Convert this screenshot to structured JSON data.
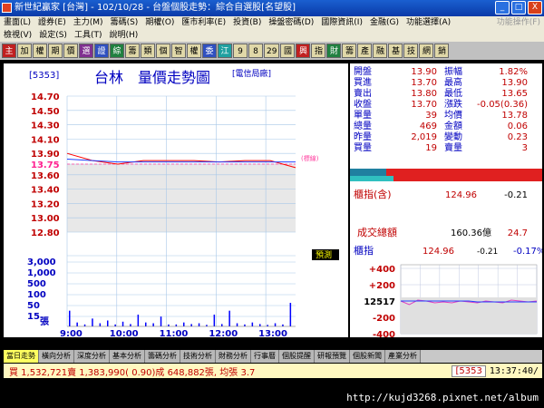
{
  "window": {
    "title": "新世紀贏家 [台灣] - 102/10/28 - 台盤個股走勢：綜合自選股[名望股]",
    "min": "_",
    "max": "□",
    "close": "X"
  },
  "menu": {
    "row1": [
      "畫面(L)",
      "證券(E)",
      "主力(M)",
      "籌碼(S)",
      "期權(O)",
      "匯市利率(E)",
      "投資(B)",
      "操盤密碼(D)",
      "國際資訊(I)",
      "金融(G)",
      "功能選擇(A)"
    ],
    "row1_right": "功能操作(F)",
    "row2": [
      "檢視(V)",
      "設定(S)",
      "工具(T)",
      "說明(H)"
    ]
  },
  "toolbar": [
    "主",
    "加",
    "權",
    "期",
    "價",
    "選",
    "證",
    "綜",
    "籌",
    "類",
    "個",
    "智",
    "權",
    "委",
    "江",
    "9",
    "8",
    "29",
    "國",
    "興",
    "指",
    "財",
    "籌",
    "產",
    "融",
    "基",
    "技",
    "網",
    "銷"
  ],
  "chart": {
    "code": "[5353]",
    "name": "台林",
    "title": "量價走勢圖",
    "industry": "[電信局廠]",
    "ref_label": "(標線)",
    "predict": "預測",
    "price_ticks": [
      "14.70",
      "14.50",
      "14.30",
      "14.10",
      "13.90",
      "13.75",
      "13.60",
      "13.40",
      "13.20",
      "13.00",
      "12.80"
    ],
    "ref_tick": "13.75",
    "vol_ticks": [
      "3,000",
      "1,000",
      "500",
      "100",
      "50",
      "15"
    ],
    "vol_unit": "張",
    "time_ticks": [
      "9:00",
      "10:00",
      "11:00",
      "12:00",
      "13:00"
    ]
  },
  "chart_data": {
    "type": "line",
    "title": "量價走勢圖",
    "xlabel": "",
    "ylabel": "",
    "ylim": [
      12.8,
      14.7
    ],
    "reference": 13.75,
    "x": [
      "9:00",
      "9:30",
      "10:00",
      "10:30",
      "11:00",
      "11:30",
      "12:00",
      "12:30",
      "13:00",
      "13:30"
    ],
    "series": [
      {
        "values": [
          13.9,
          13.8,
          13.75,
          13.8,
          13.8,
          13.8,
          13.78,
          13.8,
          13.8,
          13.7
        ],
        "color": "#ff0000"
      },
      {
        "values": [
          13.82,
          13.8,
          13.78,
          13.78,
          13.78,
          13.78,
          13.78,
          13.78,
          13.78,
          13.78
        ],
        "color": "#2040ff"
      }
    ],
    "volumes": [
      40,
      10,
      5,
      20,
      8,
      15,
      5,
      12,
      6,
      30,
      10,
      8,
      25,
      5,
      5,
      10,
      6,
      8,
      4,
      30,
      6,
      40,
      8,
      5,
      10,
      6,
      4,
      8,
      5,
      60
    ]
  },
  "quote": {
    "rows": [
      {
        "l1": "開盤",
        "v1": "13.90",
        "l2": "振幅",
        "v2": "1.82%"
      },
      {
        "l1": "買進",
        "v1": "13.70",
        "l2": "最高",
        "v2": "13.90"
      },
      {
        "l1": "賣出",
        "v1": "13.80",
        "l2": "最低",
        "v2": "13.65"
      },
      {
        "l1": "收盤",
        "v1": "13.70",
        "l2": "漲跌",
        "v2": "-0.05(0.36)"
      },
      {
        "l1": "單量",
        "v1": "39",
        "l2": "均價",
        "v2": "13.78"
      },
      {
        "l1": "總量",
        "v1": "469",
        "l2": "金額",
        "v2": "0.06"
      },
      {
        "l1": "昨量",
        "v1": "2,019",
        "l2": "變動",
        "v2": "0.23"
      },
      {
        "l1": "買量",
        "v1": "19",
        "l2": "賣量",
        "v2": "3"
      }
    ],
    "otc_label": "櫃指(含)",
    "otc_value": "124.96",
    "otc_change": "-0.21",
    "turnover_label": "成交總額",
    "turnover_value": "160.36億",
    "turnover_change": "24.7"
  },
  "mini": {
    "label": "櫃指",
    "value": "124.96",
    "change": "-0.21",
    "pct": "-0.17%",
    "ticks": [
      "+400",
      "+200",
      "12517",
      "-200",
      "-400"
    ]
  },
  "tabs": [
    "當日走勢",
    "橫向分析",
    "深度分析",
    "基本分析",
    "籌碼分析",
    "技術分析",
    "財務分析",
    "行事曆",
    "個股提醒",
    "研報預覽",
    "個股新聞",
    "產業分析"
  ],
  "status": {
    "trade": "買 1,532,721賣 1,383,990( 0.90)成 648,882張, 均張 3.7",
    "code": "[5353",
    "time": "13:37:40/"
  },
  "url": "http://kujd3268.pixnet.net/album"
}
